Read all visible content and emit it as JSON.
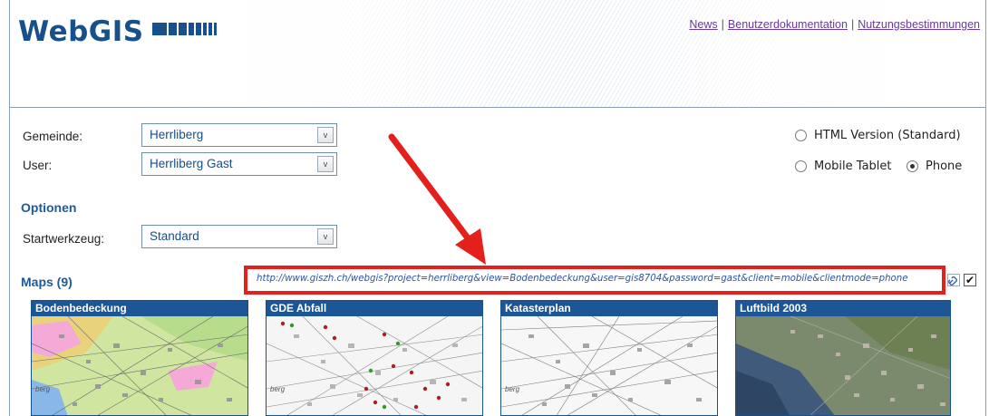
{
  "header": {
    "logo_text": "WebGIS",
    "links": [
      "News",
      "Benutzerdokumentation",
      "Nutzungsbestimmungen"
    ],
    "separator": "|"
  },
  "form": {
    "gemeinde_label": "Gemeinde:",
    "gemeinde_value": "Herrliberg",
    "user_label": "User:",
    "user_value": "Herrliberg Gast",
    "optionen_title": "Optionen",
    "startwerkzeug_label": "Startwerkzeug:",
    "startwerkzeug_value": "Standard",
    "dropdown_glyph": "v"
  },
  "version_options": {
    "html": "HTML Version (Standard)",
    "tablet": "Mobile Tablet",
    "phone": "Phone",
    "selected": "phone"
  },
  "maps": {
    "title": "Maps (9)",
    "url": "http://www.giszh.ch/webgis?project=herrliberg&view=Bodenbedeckung&user=gis8704&password=gast&client=mobile&clientmode=phone",
    "checkbox_mark": "✔",
    "items": [
      {
        "title": "Bodenbedeckung",
        "caption": "berg"
      },
      {
        "title": "GDE Abfall",
        "caption": "berg"
      },
      {
        "title": "Katasterplan",
        "caption": "berg"
      },
      {
        "title": "Luftbild 2003",
        "caption": ""
      }
    ]
  },
  "colors": {
    "brand": "#17508a",
    "link": "#6a3a9a",
    "annotation": "#e3201b"
  },
  "icons": {
    "dropdown": "chevron-down-icon",
    "link": "link-icon",
    "checkbox": "checkbox-checked"
  }
}
